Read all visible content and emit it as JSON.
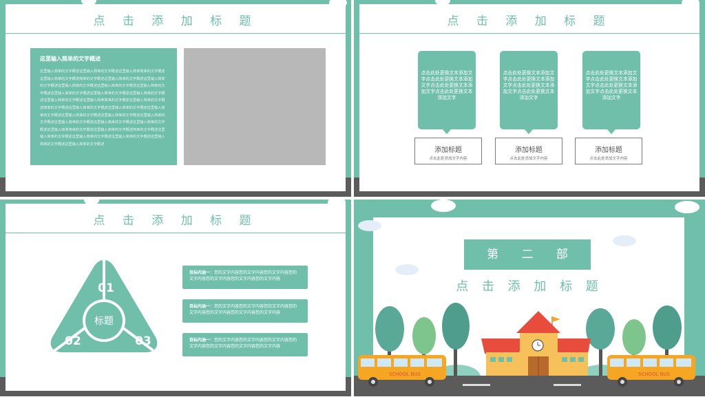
{
  "colors": {
    "accent": "#6fbfab",
    "road": "#5b5b5b",
    "placeholder": "#b8b8b8",
    "school_wall": "#f6c05a",
    "school_roof": "#e74c3c",
    "bus": "#f5a623"
  },
  "slide1": {
    "title": "点 击 添 加 标 题",
    "box_heading": "这里输入简单的文字概述",
    "box_text": "这里输入简单的文字概述这里输入简单的文字概述这里输入简单简单的文字概述这里输入简单的文字概述简单的文字概述这里输入简单的文字概述这里输入简单的文字概述这里输入简单的文字概述这里输入简单的文字概述这里输入简单的文字概述这里输入简单的文字概述这里输入简单的文字概述这里输入简单的文字概述这里输入简单的文字概述这里输入简单简单的文字概述这里输入简单的文字概述简单的文字概述这里输入简单的文字概述这里输入简单的文字概述这里输入简单的文字概述这里输入简单的文字概述这里输入简单的文字概述这里输入简单的文字概述这里输入简单的文字概述这里输入简单的文字概述这里输入简单的文字概述这里输入简单简单的文字概述这里输入简单的文字概述简单的文字概述这里输入简单的文字概述这里输入简单的文字概述这里输入简单的文字概述这里输入简单的文字概述这里输入简单的文字概述"
  },
  "slide2": {
    "title": "点 击 添 加 标 题",
    "bubbles": [
      "点击此处更换文本添加文字点击此处更换文本添加文字点击此处更换文本添加文字点击此处更换文本添加文字",
      "点击此处更换文本添加文字点击此处更换文本添加文字点击此处更换文本添加文字点击此处更换文本添加文字",
      "点击此处更换文本添加文字点击此处更换文本添加文字点击此处更换文本添加文字点击此处更换文本添加文字"
    ],
    "boxes": [
      {
        "title": "添加标题",
        "sub": "点击此处添加文字内容"
      },
      {
        "title": "添加标题",
        "sub": "点击此处添加文字内容"
      },
      {
        "title": "添加标题",
        "sub": "点击此处添加文字内容"
      }
    ]
  },
  "slide3": {
    "title": "点 击 添 加 标 题",
    "center": "标题",
    "labels": [
      "01",
      "02",
      "03"
    ],
    "items": [
      {
        "label": "目标内涵一：",
        "text": "您的文字内容您的文字内容您的文字内容您的文字内容您的文字内容您的文字内容您的文字内容"
      },
      {
        "label": "目标内涵一：",
        "text": "您的文字内容您的文字内容您的文字内容您的文字内容您的文字内容您的文字内容您的文字内容"
      },
      {
        "label": "目标内涵一：",
        "text": "您的文字内容您的文字内容您的文字内容您的文字内容您的文字内容您的文字内容您的文字内容"
      }
    ]
  },
  "slide4": {
    "part": "第 二 部 分",
    "subtitle": "点 击 添 加 标 题",
    "bus_label": "SCHOOL BUS"
  }
}
